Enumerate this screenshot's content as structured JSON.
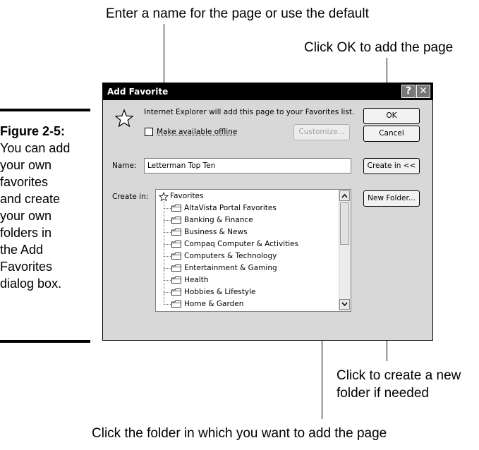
{
  "callouts": {
    "top": "Enter a name for the page or use the default",
    "ok": "Click OK to add the page",
    "new_folder_1": "Click to create a new",
    "new_folder_2": "folder if needed",
    "bottom": "Click the folder in which you want to add the page"
  },
  "caption": {
    "number": "Figure 2-5:",
    "lines": [
      "You can add",
      "your own",
      "favorites",
      "and create",
      "your own",
      "folders in",
      "the Add",
      "Favorites",
      "dialog box."
    ]
  },
  "dialog": {
    "title": "Add Favorite",
    "help_button": "?",
    "close_button": "✕",
    "message": "Internet Explorer will add this page to your Favorites list.",
    "offline_checkbox_label": "Make available offline",
    "offline_checked": false,
    "customize_button": "Customize...",
    "ok_button": "OK",
    "cancel_button": "Cancel",
    "name_label": "Name:",
    "name_value": "Letterman Top Ten",
    "create_in_button": "Create in <<",
    "create_in_label": "Create in:",
    "new_folder_button": "New Folder...",
    "tree": {
      "root": "Favorites",
      "folders": [
        "AltaVista Portal Favorites",
        "Banking & Finance",
        "Business & News",
        "Compaq Computer & Activities",
        "Computers & Technology",
        "Entertainment & Gaming",
        "Health",
        "Hobbies & Lifestyle",
        "Home & Garden"
      ]
    },
    "icons": {
      "star": "favorites-star-icon",
      "folder": "folder-icon"
    }
  }
}
